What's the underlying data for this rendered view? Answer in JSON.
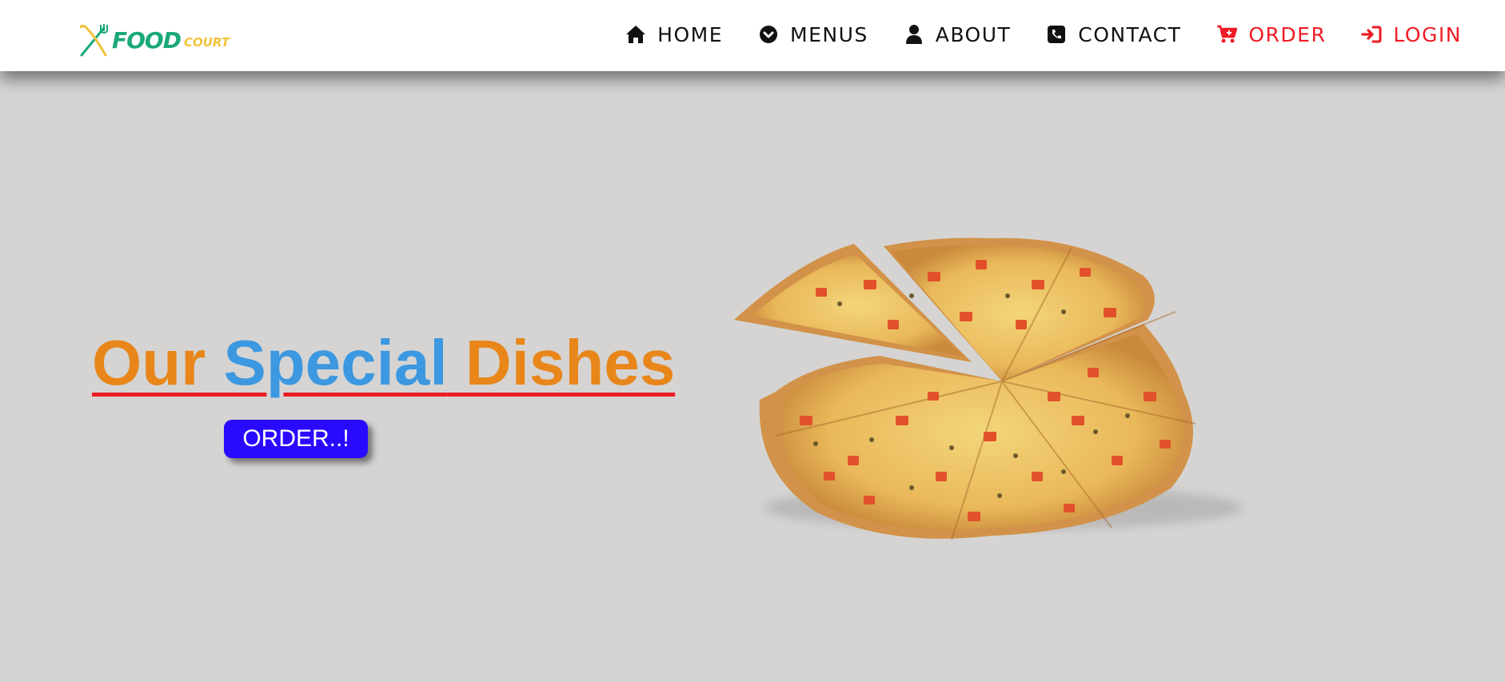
{
  "header": {
    "logo": {
      "icon": "fork-knife-icon",
      "text_primary": "FOOD",
      "text_secondary": "COURT"
    },
    "nav": [
      {
        "label": "HOME",
        "icon": "home-icon"
      },
      {
        "label": "MENUS",
        "icon": "chevron-circle-icon"
      },
      {
        "label": "ABOUT",
        "icon": "user-icon"
      },
      {
        "label": "CONTACT",
        "icon": "phone-icon"
      },
      {
        "label": "ORDER",
        "icon": "cart-icon"
      },
      {
        "label": "LOGIN",
        "icon": "login-icon"
      }
    ]
  },
  "hero": {
    "title_words": [
      "Our ",
      "S",
      "pecial",
      " Dishes"
    ],
    "order_button_label": "ORDER..!",
    "image": "pizza"
  },
  "colors": {
    "background": "#d5d4d3",
    "title_orange": "#e8861a",
    "title_blue": "#3c98e0",
    "accent_red": "#ee1c25",
    "button_blue": "#2a0aff",
    "logo_green": "#1aa87a",
    "logo_yellow": "#f2c23a"
  }
}
